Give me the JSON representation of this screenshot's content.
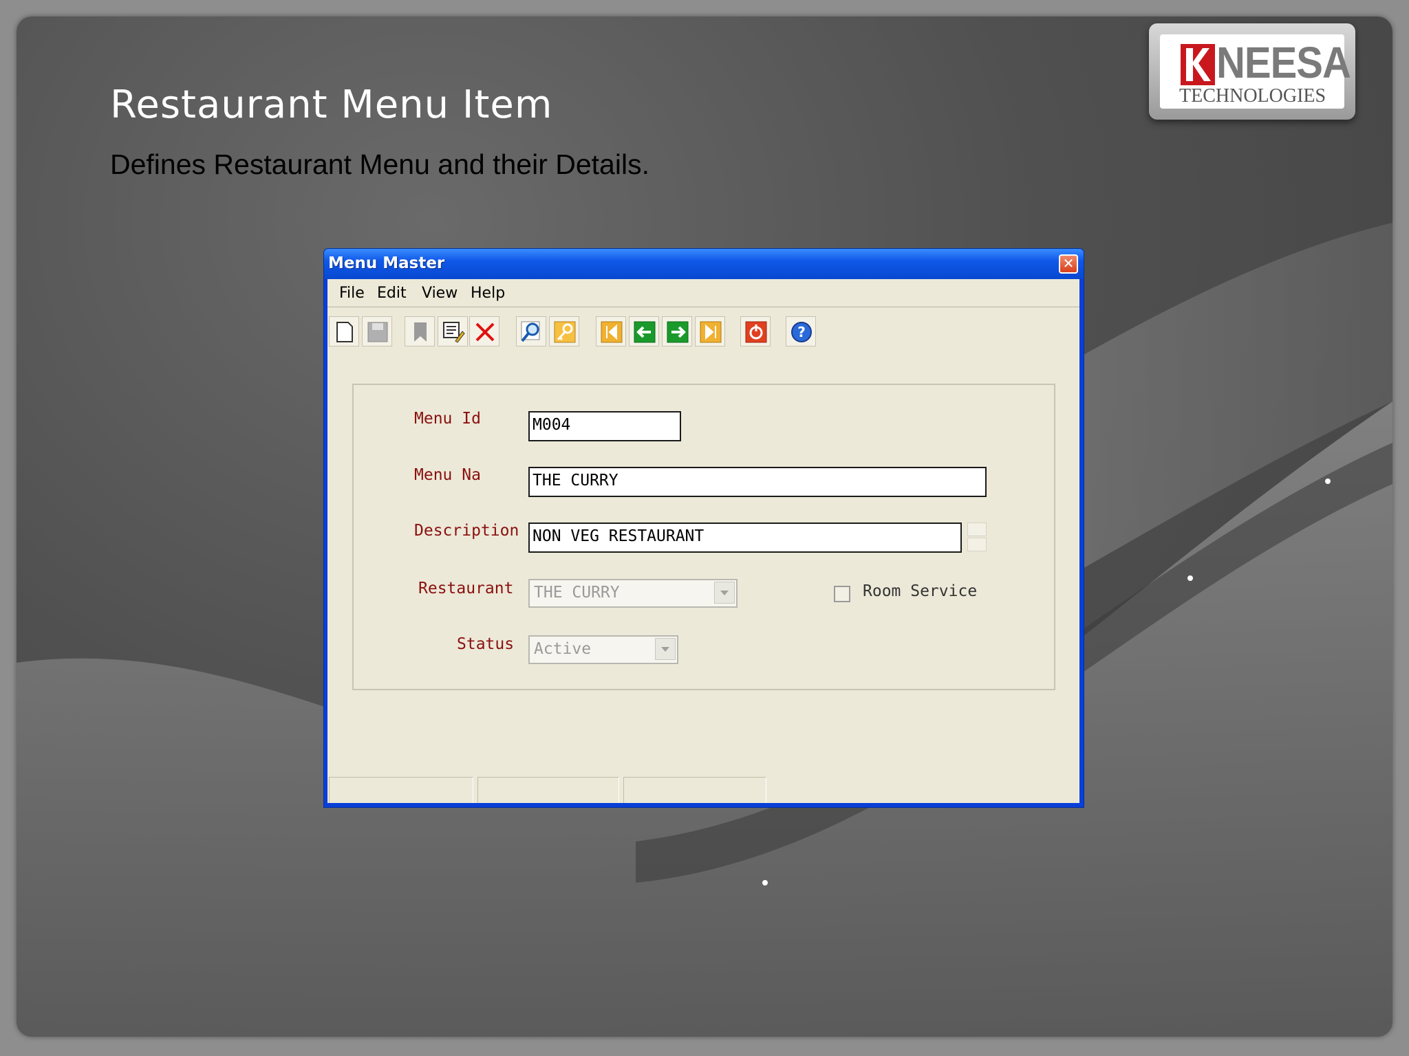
{
  "slide": {
    "title": "Restaurant Menu Item",
    "subtitle": "Defines Restaurant Menu and their Details."
  },
  "logo": {
    "word": "NEESA",
    "tagline": "TECHNOLOGIES"
  },
  "window": {
    "title": "Menu Master",
    "close_glyph": "✕",
    "menu": [
      "File",
      "Edit",
      "View",
      "Help"
    ],
    "toolbar_icons": [
      "new-icon",
      "save-icon",
      "bookmark-icon",
      "edit-icon",
      "delete-icon",
      "find-icon",
      "key-icon",
      "first-record-icon",
      "previous-record-icon",
      "next-record-icon",
      "last-record-icon",
      "exit-icon",
      "help-icon"
    ]
  },
  "form": {
    "menu_id_label": "Menu Id",
    "menu_id_value": "M004",
    "menu_name_label": "Menu Na",
    "menu_name_value": "THE CURRY",
    "description_label": "Description",
    "description_value": "NON VEG RESTAURANT",
    "restaurant_label": "Restaurant",
    "restaurant_value": "THE CURRY",
    "room_service_label": "Room Service",
    "room_service_checked": false,
    "status_label": "Status",
    "status_value": "Active"
  },
  "colors": {
    "label_red": "#8a1010",
    "window_blue": "#0a3fd8",
    "client_bg": "#ece9d8"
  }
}
